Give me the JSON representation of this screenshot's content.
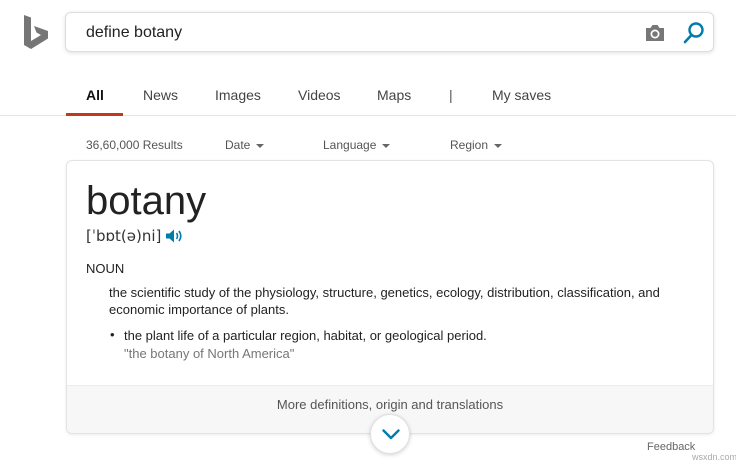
{
  "search": {
    "query": "define botany"
  },
  "nav": {
    "tabs": [
      {
        "label": "All",
        "active": true
      },
      {
        "label": "News"
      },
      {
        "label": "Images"
      },
      {
        "label": "Videos"
      },
      {
        "label": "Maps"
      },
      {
        "label": "|"
      },
      {
        "label": "My saves"
      }
    ]
  },
  "filters": {
    "results_count": "36,60,000 Results",
    "date": "Date",
    "language": "Language",
    "region": "Region"
  },
  "definition": {
    "word": "botany",
    "pronunciation": "[ˈbɒt(ə)ni]",
    "part_of_speech": "NOUN",
    "definition_1": "the scientific study of the physiology, structure, genetics, ecology, distribution, classification, and economic importance of plants.",
    "bullet": "•",
    "definition_2": "the plant life of a particular region, habitat, or geological period.",
    "example": "\"the botany of North America\"",
    "more_link": "More definitions, origin and translations"
  },
  "footer": {
    "feedback": "Feedback",
    "watermark": "wsxdn.com"
  },
  "colors": {
    "accent": "#c1391a",
    "link_teal": "#007daa",
    "logo_gray": "#767676"
  },
  "icons": {
    "logo": "bing-logo",
    "camera": "camera-icon",
    "search": "search-icon",
    "speaker": "speaker-icon",
    "expand": "chevron-down-icon"
  }
}
